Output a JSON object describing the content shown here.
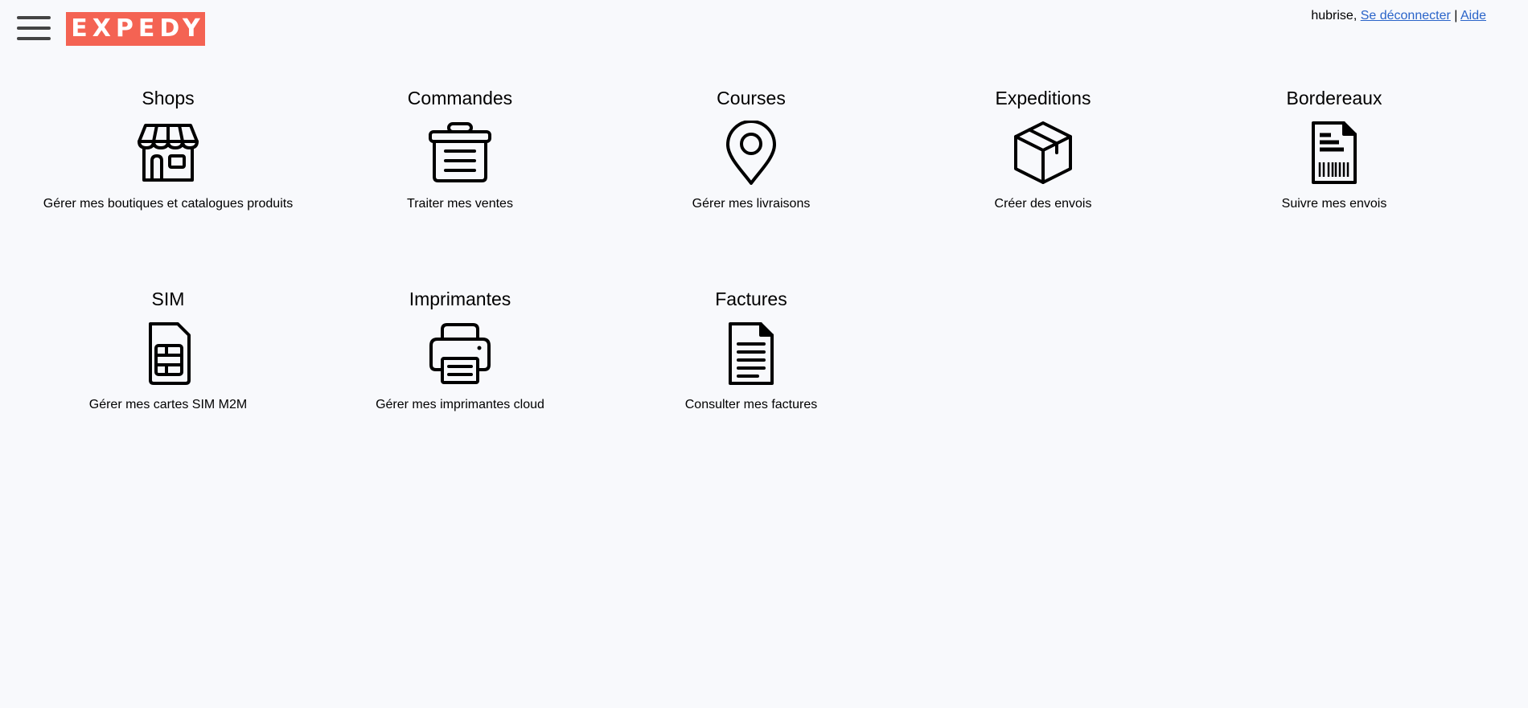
{
  "header": {
    "logo_text": "EXPEDY",
    "logo_color": "#f46353",
    "username": "hubrise,",
    "logout_label": "Se déconnecter",
    "separator": "|",
    "help_label": "Aide",
    "menu_icon": "hamburger-menu-icon"
  },
  "tiles": [
    {
      "title": "Shops",
      "icon": "storefront-icon",
      "description": "Gérer mes boutiques et catalogues produits"
    },
    {
      "title": "Commandes",
      "icon": "basket-icon",
      "description": "Traiter mes ventes"
    },
    {
      "title": "Courses",
      "icon": "map-pin-icon",
      "description": "Gérer mes livraisons"
    },
    {
      "title": "Expeditions",
      "icon": "package-box-icon",
      "description": "Créer des envois"
    },
    {
      "title": "Bordereaux",
      "icon": "barcode-document-icon",
      "description": "Suivre mes envois"
    },
    {
      "title": "SIM",
      "icon": "sim-card-icon",
      "description": "Gérer mes cartes SIM M2M"
    },
    {
      "title": "Imprimantes",
      "icon": "printer-icon",
      "description": "Gérer mes imprimantes cloud"
    },
    {
      "title": "Factures",
      "icon": "invoice-document-icon",
      "description": "Consulter mes factures"
    }
  ]
}
